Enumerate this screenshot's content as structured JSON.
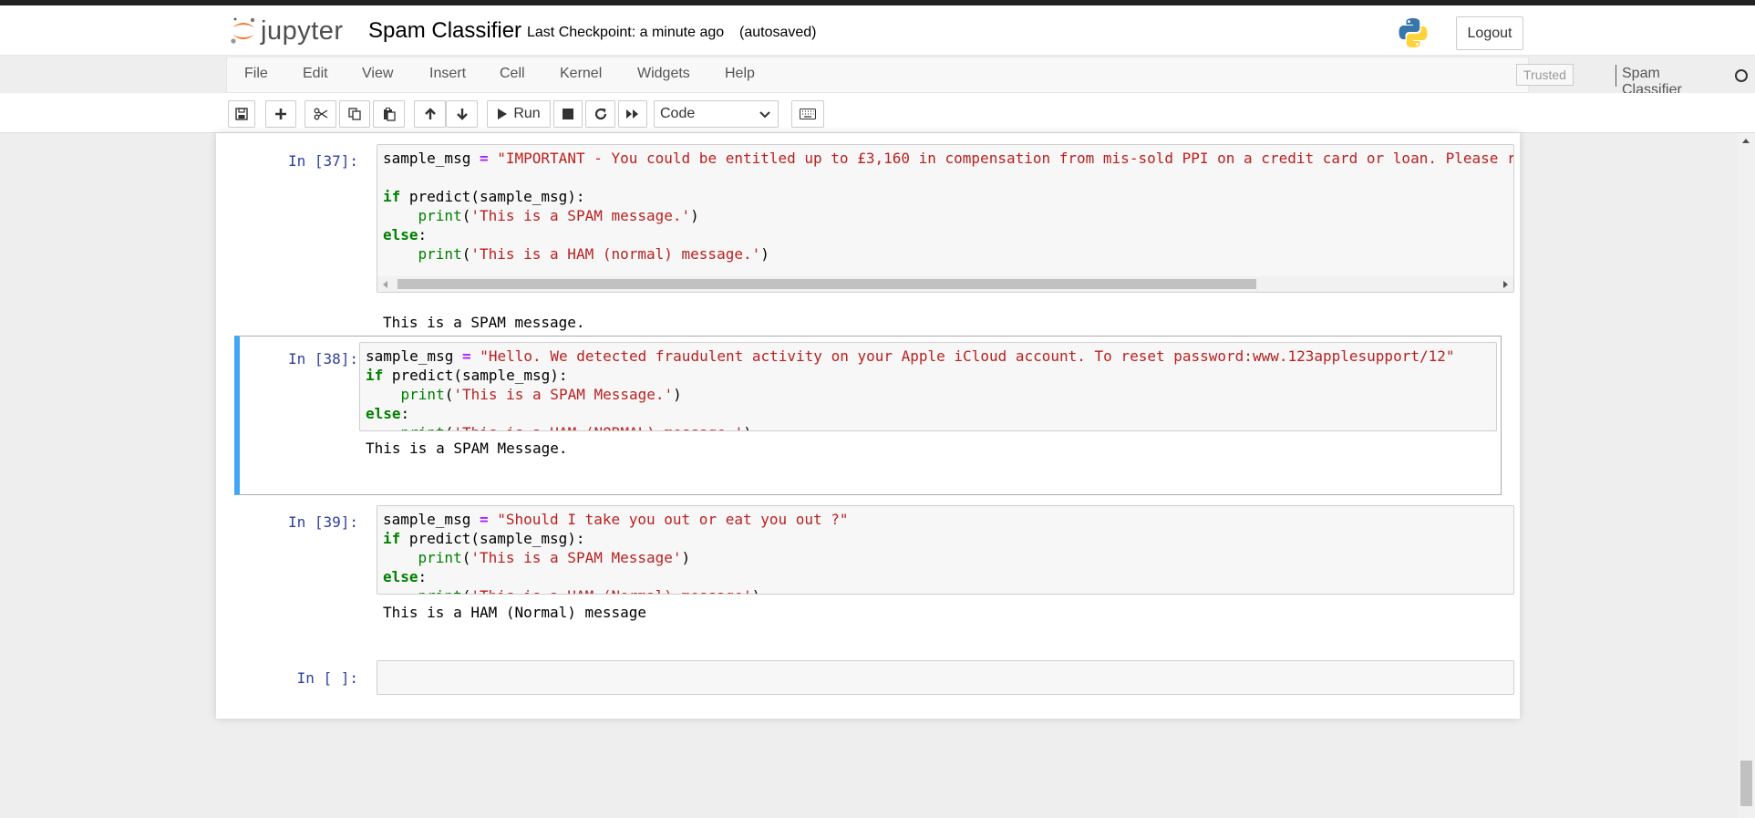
{
  "header": {
    "logo_text": "jupyter",
    "notebook_title": "Spam Classifier",
    "checkpoint": "Last Checkpoint: a minute ago",
    "autosaved": "(autosaved)",
    "logout_label": "Logout"
  },
  "menubar": {
    "items": [
      "File",
      "Edit",
      "View",
      "Insert",
      "Cell",
      "Kernel",
      "Widgets",
      "Help"
    ],
    "trusted_label": "Trusted",
    "kernel_name": "Spam Classifier"
  },
  "toolbar": {
    "run_label": "Run",
    "cell_type": "Code",
    "icons": [
      "save-icon",
      "plus-icon",
      "cut-icon",
      "copy-icon",
      "paste-icon",
      "arrow-up-icon",
      "arrow-down-icon",
      "run-icon",
      "stop-icon",
      "restart-icon",
      "fast-forward-icon",
      "keyboard-icon"
    ]
  },
  "cells": [
    {
      "prompt": "In [37]:",
      "code": {
        "l1_var": "sample_msg",
        "l1_op": "=",
        "l1_str": "\"IMPORTANT - You could be entitled up to £3,160 in compensation from mis-sold PPI on a credit card or loan. Please r",
        "if_kw": "if",
        "if_rest": "predict(sample_msg):",
        "print1_fn": "print",
        "print1_str": "'This is a SPAM message.'",
        "else_kw": "else",
        "print2_fn": "print",
        "print2_str": "'This is a HAM (normal) message.'"
      },
      "output": "This is a SPAM message."
    },
    {
      "prompt": "In [38]:",
      "code": {
        "l1_var": "sample_msg",
        "l1_op": "=",
        "l1_str": "\"Hello. We detected fraudulent activity on your Apple iCloud account. To reset password:www.123applesupport/12\"",
        "if_kw": "if",
        "if_rest": "predict(sample_msg):",
        "print1_fn": "print",
        "print1_str": "'This is a SPAM Message.'",
        "else_kw": "else",
        "print2_fn": "print",
        "print2_str": "'This is a HAM (NORMAL) message.'"
      },
      "output": "This is a SPAM Message."
    },
    {
      "prompt": "In [39]:",
      "code": {
        "l1_var": "sample_msg",
        "l1_op": "=",
        "l1_str": "\"Should I take you out or eat you out ?\"",
        "if_kw": "if",
        "if_rest": "predict(sample_msg):",
        "print1_fn": "print",
        "print1_str": "'This is a SPAM Message'",
        "else_kw": "else",
        "print2_fn": "print",
        "print2_str": "'This is a HAM (Normal) message'"
      },
      "output": "This is a HAM (Normal) message"
    },
    {
      "prompt": "In [ ]:"
    }
  ],
  "colors": {
    "accent_selected": "#42a5f5",
    "prompt": "#303f9f",
    "keyword": "#008000",
    "string": "#ba2121",
    "operator": "#aa22ff"
  }
}
